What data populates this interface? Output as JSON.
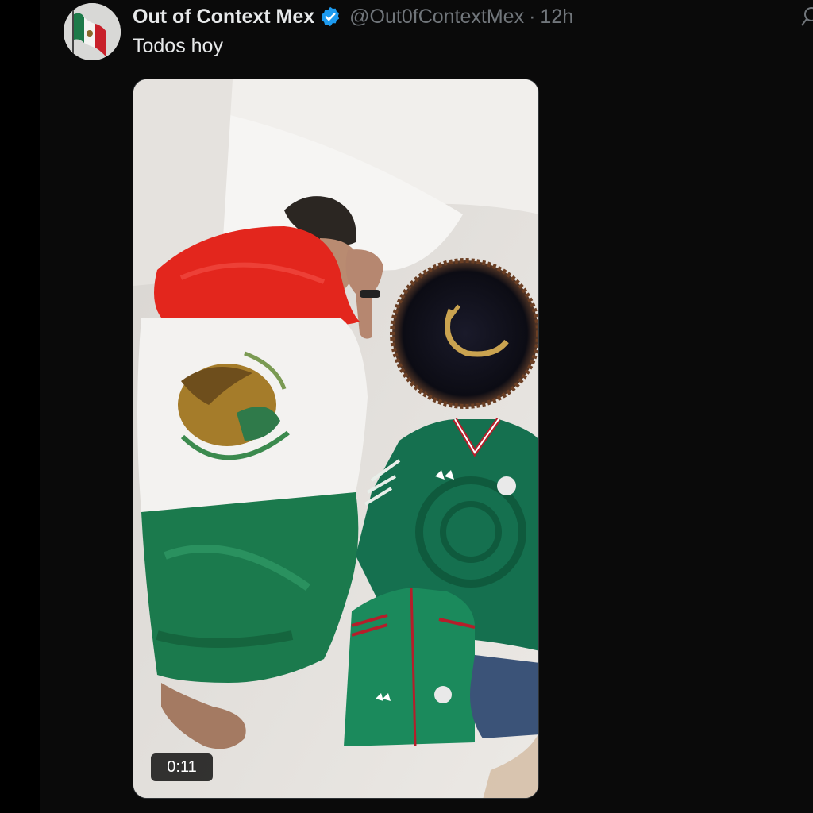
{
  "tweet": {
    "display_name": "Out of Context Mex",
    "handle": "@Out0fContextMex",
    "separator": "·",
    "time": "12h",
    "text": "Todos hoy",
    "verified": true,
    "verified_color": "#1d9bf0"
  },
  "media": {
    "type": "video",
    "duration": "0:11"
  },
  "icons": {
    "verified": "verified-badge-icon",
    "grok": "grok-icon"
  },
  "colors": {
    "background": "#0a0a0a",
    "text_primary": "#e7e9ea",
    "text_secondary": "#71767b",
    "flag_green": "#1b7a4d",
    "flag_red": "#e2271d"
  }
}
